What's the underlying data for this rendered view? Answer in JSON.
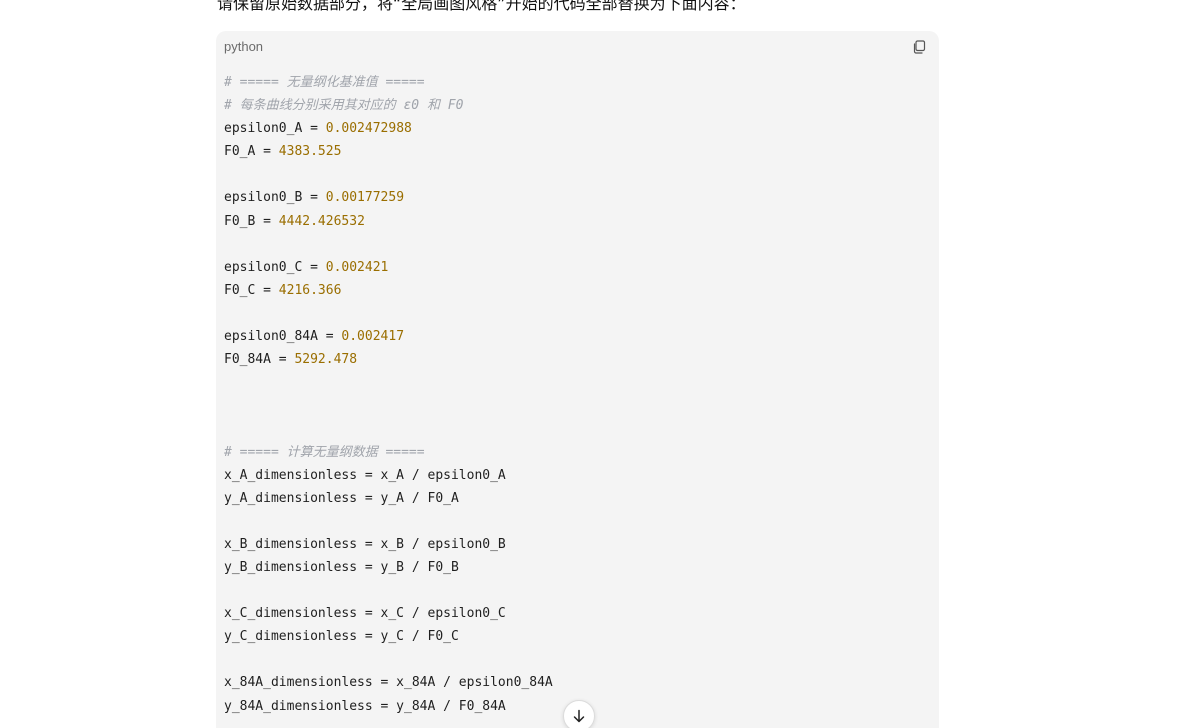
{
  "intro_text": "请保留原始数据部分，将“全局画图风格”开始的代码全部替换为下面内容：",
  "code_block": {
    "language": "python",
    "copy_icon": "copy-icon",
    "lines": [
      {
        "comment": "# ===== 无量纲化基准值 ====="
      },
      {
        "comment": "# 每条曲线分别采用其对应的 ε0 和 F0"
      },
      {
        "text": "epsilon0_A = ",
        "num": "0.002472988"
      },
      {
        "text": "F0_A = ",
        "num": "4383.525"
      },
      {
        "text": ""
      },
      {
        "text": "epsilon0_B = ",
        "num": "0.00177259"
      },
      {
        "text": "F0_B = ",
        "num": "4442.426532"
      },
      {
        "text": ""
      },
      {
        "text": "epsilon0_C = ",
        "num": "0.002421"
      },
      {
        "text": "F0_C = ",
        "num": "4216.366"
      },
      {
        "text": ""
      },
      {
        "text": "epsilon0_84A = ",
        "num": "0.002417"
      },
      {
        "text": "F0_84A = ",
        "num": "5292.478"
      },
      {
        "text": ""
      },
      {
        "text": ""
      },
      {
        "text": ""
      },
      {
        "comment": "# ===== 计算无量纲数据 ====="
      },
      {
        "text": "x_A_dimensionless = x_A / epsilon0_A"
      },
      {
        "text": "y_A_dimensionless = y_A / F0_A"
      },
      {
        "text": ""
      },
      {
        "text": "x_B_dimensionless = x_B / epsilon0_B"
      },
      {
        "text": "y_B_dimensionless = y_B / F0_B"
      },
      {
        "text": ""
      },
      {
        "text": "x_C_dimensionless = x_C / epsilon0_C"
      },
      {
        "text": "y_C_dimensionless = y_C / F0_C"
      },
      {
        "text": ""
      },
      {
        "text": "x_84A_dimensionless = x_84A / epsilon0_84A"
      },
      {
        "text": "y_84A_dimensionless = y_84A / F0_84A"
      }
    ]
  },
  "scroll_button": {
    "icon": "arrow-down-icon"
  },
  "colors": {
    "comment": "#a0a4ab",
    "number": "#9a6e00",
    "code_background": "#f4f4f4"
  }
}
